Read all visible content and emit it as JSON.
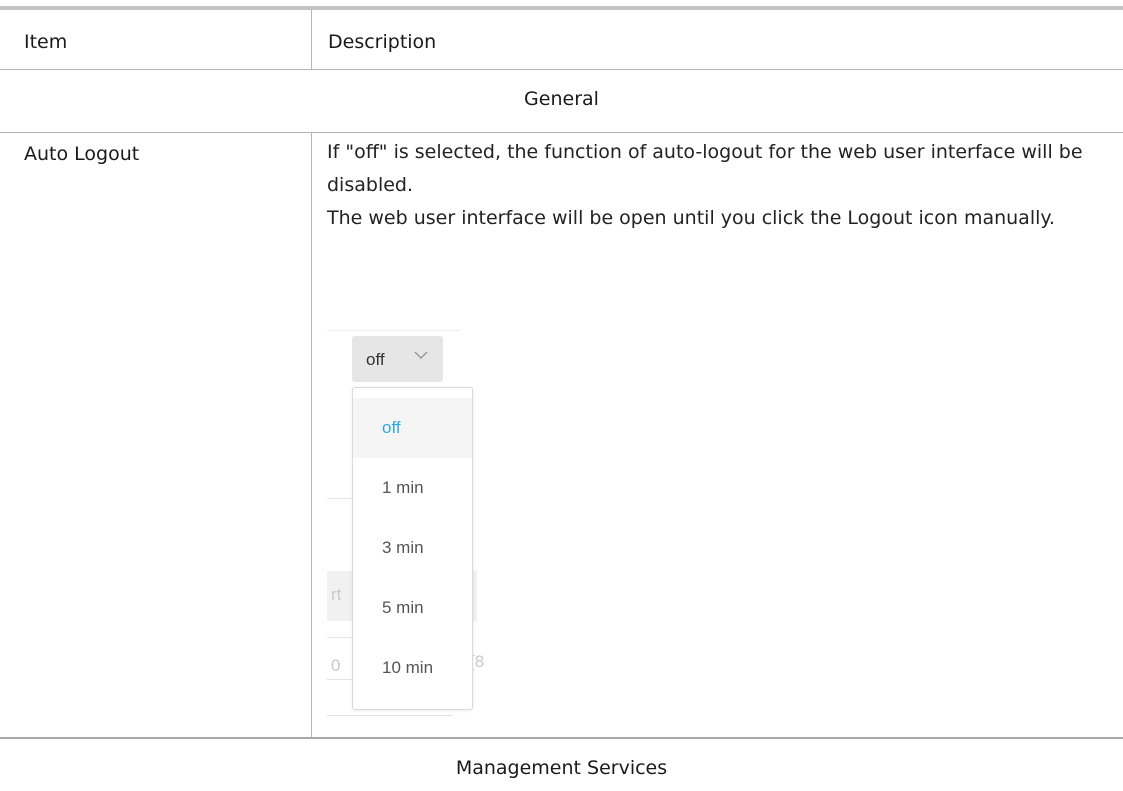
{
  "table": {
    "headers": {
      "item": "Item",
      "description": "Description"
    },
    "sections": [
      {
        "title": "General"
      },
      {
        "title": "Management Services"
      }
    ],
    "rows": [
      {
        "item": "Auto Logout",
        "description": [
          "If \"off\" is selected, the function of auto-logout for the web user interface will be disabled.",
          "The web user interface will be open until you click the Logout icon manually."
        ]
      }
    ]
  },
  "auto_logout_select": {
    "value": "off",
    "options": [
      "off",
      "1 min",
      "3 min",
      "5 min",
      "10 min"
    ],
    "selected_color": "#2fa6e4"
  },
  "background_fragments": [
    "rt",
    "0",
    "[8"
  ],
  "colors": {
    "rule": "#c4c4c4",
    "divider": "#b5b5b5",
    "select_bg": "#e6e6e6"
  }
}
